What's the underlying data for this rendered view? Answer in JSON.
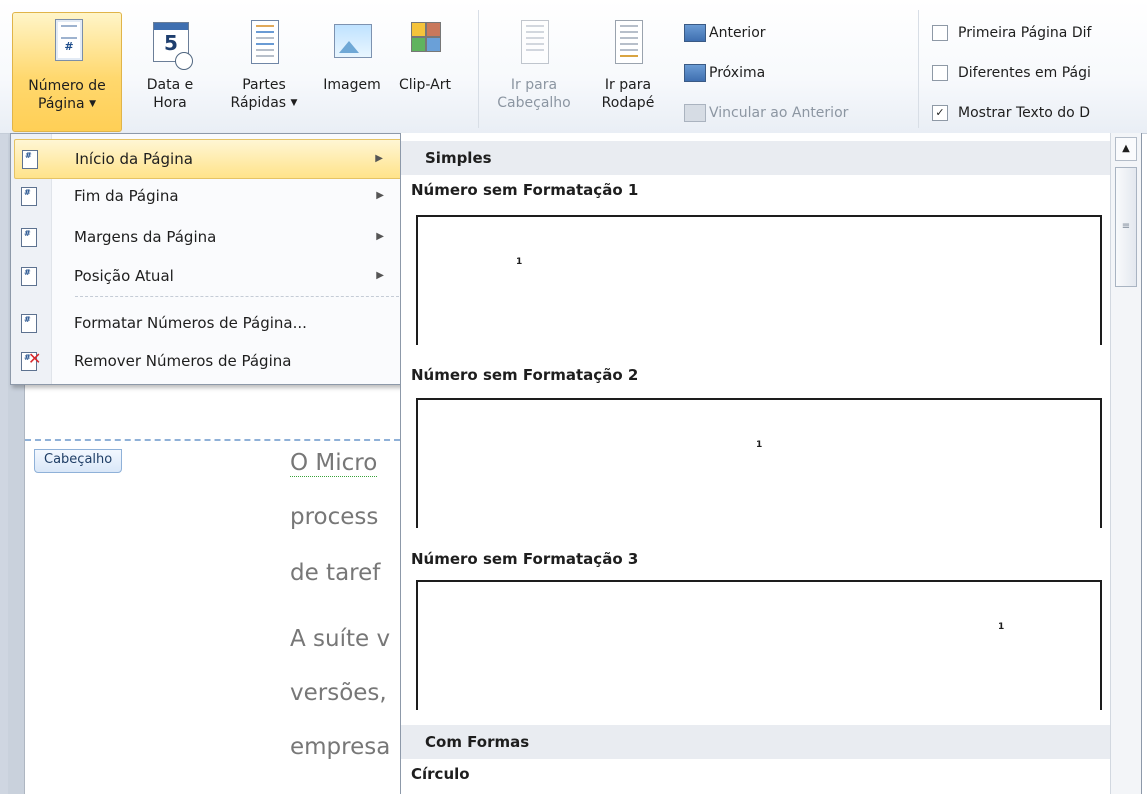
{
  "ribbon": {
    "page_number": {
      "line1": "Número de",
      "line2": "Página",
      "icon": "page-number-icon"
    },
    "date_time": {
      "line1": "Data e",
      "line2": "Hora",
      "icon_text": "5"
    },
    "quick_parts": {
      "line1": "Partes",
      "line2": "Rápidas"
    },
    "picture": {
      "line1": "Imagem"
    },
    "clip_art": {
      "line1": "Clip-Art"
    },
    "goto_header": {
      "line1": "Ir para",
      "line2": "Cabeçalho"
    },
    "goto_footer": {
      "line1": "Ir para",
      "line2": "Rodapé"
    },
    "previous": "Anterior",
    "next": "Próxima",
    "link_previous": "Vincular ao Anterior",
    "options": [
      {
        "label": "Primeira Página Dif",
        "checked": false
      },
      {
        "label": "Diferentes em Pági",
        "checked": false
      },
      {
        "label": "Mostrar Texto do D",
        "checked": true
      }
    ]
  },
  "menu": {
    "items": [
      {
        "label": "Início da Página",
        "submenu": true,
        "highlighted": true
      },
      {
        "label": "Fim da Página",
        "submenu": true
      },
      {
        "label": "Margens da Página",
        "submenu": true
      },
      {
        "label": "Posição Atual",
        "submenu": true
      },
      {
        "label": "Formatar Números de Página..."
      },
      {
        "label": "Remover Números de Página"
      }
    ]
  },
  "gallery": {
    "sections": [
      {
        "title": "Simples"
      },
      {
        "title": "Com Formas"
      }
    ],
    "items": [
      {
        "label": "Número sem Formatação 1",
        "preview_number": "1"
      },
      {
        "label": "Número sem Formatação 2",
        "preview_number": "1"
      },
      {
        "label": "Número sem Formatação 3",
        "preview_number": "1"
      },
      {
        "label": "Círculo"
      }
    ]
  },
  "document": {
    "header_tag": "Cabeçalho",
    "lines": [
      "O Micro",
      "process",
      "de taref",
      "A suíte v",
      "versões,",
      "empresa"
    ]
  }
}
